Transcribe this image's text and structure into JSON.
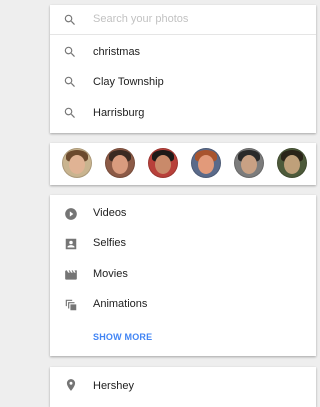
{
  "search": {
    "placeholder": "Search your photos",
    "value": "",
    "suggestions": [
      {
        "label": "christmas",
        "icon": "search-icon"
      },
      {
        "label": "Clay Township",
        "icon": "search-icon"
      },
      {
        "label": "Harrisburg",
        "icon": "search-icon"
      }
    ]
  },
  "people": {
    "avatars": [
      {
        "name": "person-1",
        "skin": "#e0b394",
        "hair": "#6b4a2e",
        "bg": "#c9b48f"
      },
      {
        "name": "person-2",
        "skin": "#d99b7e",
        "hair": "#3a2a22",
        "bg": "#8c5a46"
      },
      {
        "name": "person-3",
        "skin": "#c98a6a",
        "hair": "#1e1a18",
        "bg": "#b8403a"
      },
      {
        "name": "person-4",
        "skin": "#e29a7a",
        "hair": "#a8542e",
        "bg": "#5a6a8a"
      },
      {
        "name": "person-5",
        "skin": "#c9a184",
        "hair": "#2a2a2a",
        "bg": "#7c7c7c"
      },
      {
        "name": "person-6",
        "skin": "#bfa07a",
        "hair": "#2a2418",
        "bg": "#4d5a3a"
      }
    ]
  },
  "types": {
    "items": [
      {
        "label": "Videos",
        "icon": "play-circle-icon"
      },
      {
        "label": "Selfies",
        "icon": "portrait-icon"
      },
      {
        "label": "Movies",
        "icon": "movie-icon"
      },
      {
        "label": "Animations",
        "icon": "animation-icon"
      }
    ],
    "show_more": "SHOW MORE"
  },
  "places": {
    "items": [
      {
        "label": "Hershey",
        "icon": "place-icon"
      }
    ]
  },
  "colors": {
    "accent": "#4285f4",
    "icon": "#757575",
    "background": "#eeeeee"
  }
}
